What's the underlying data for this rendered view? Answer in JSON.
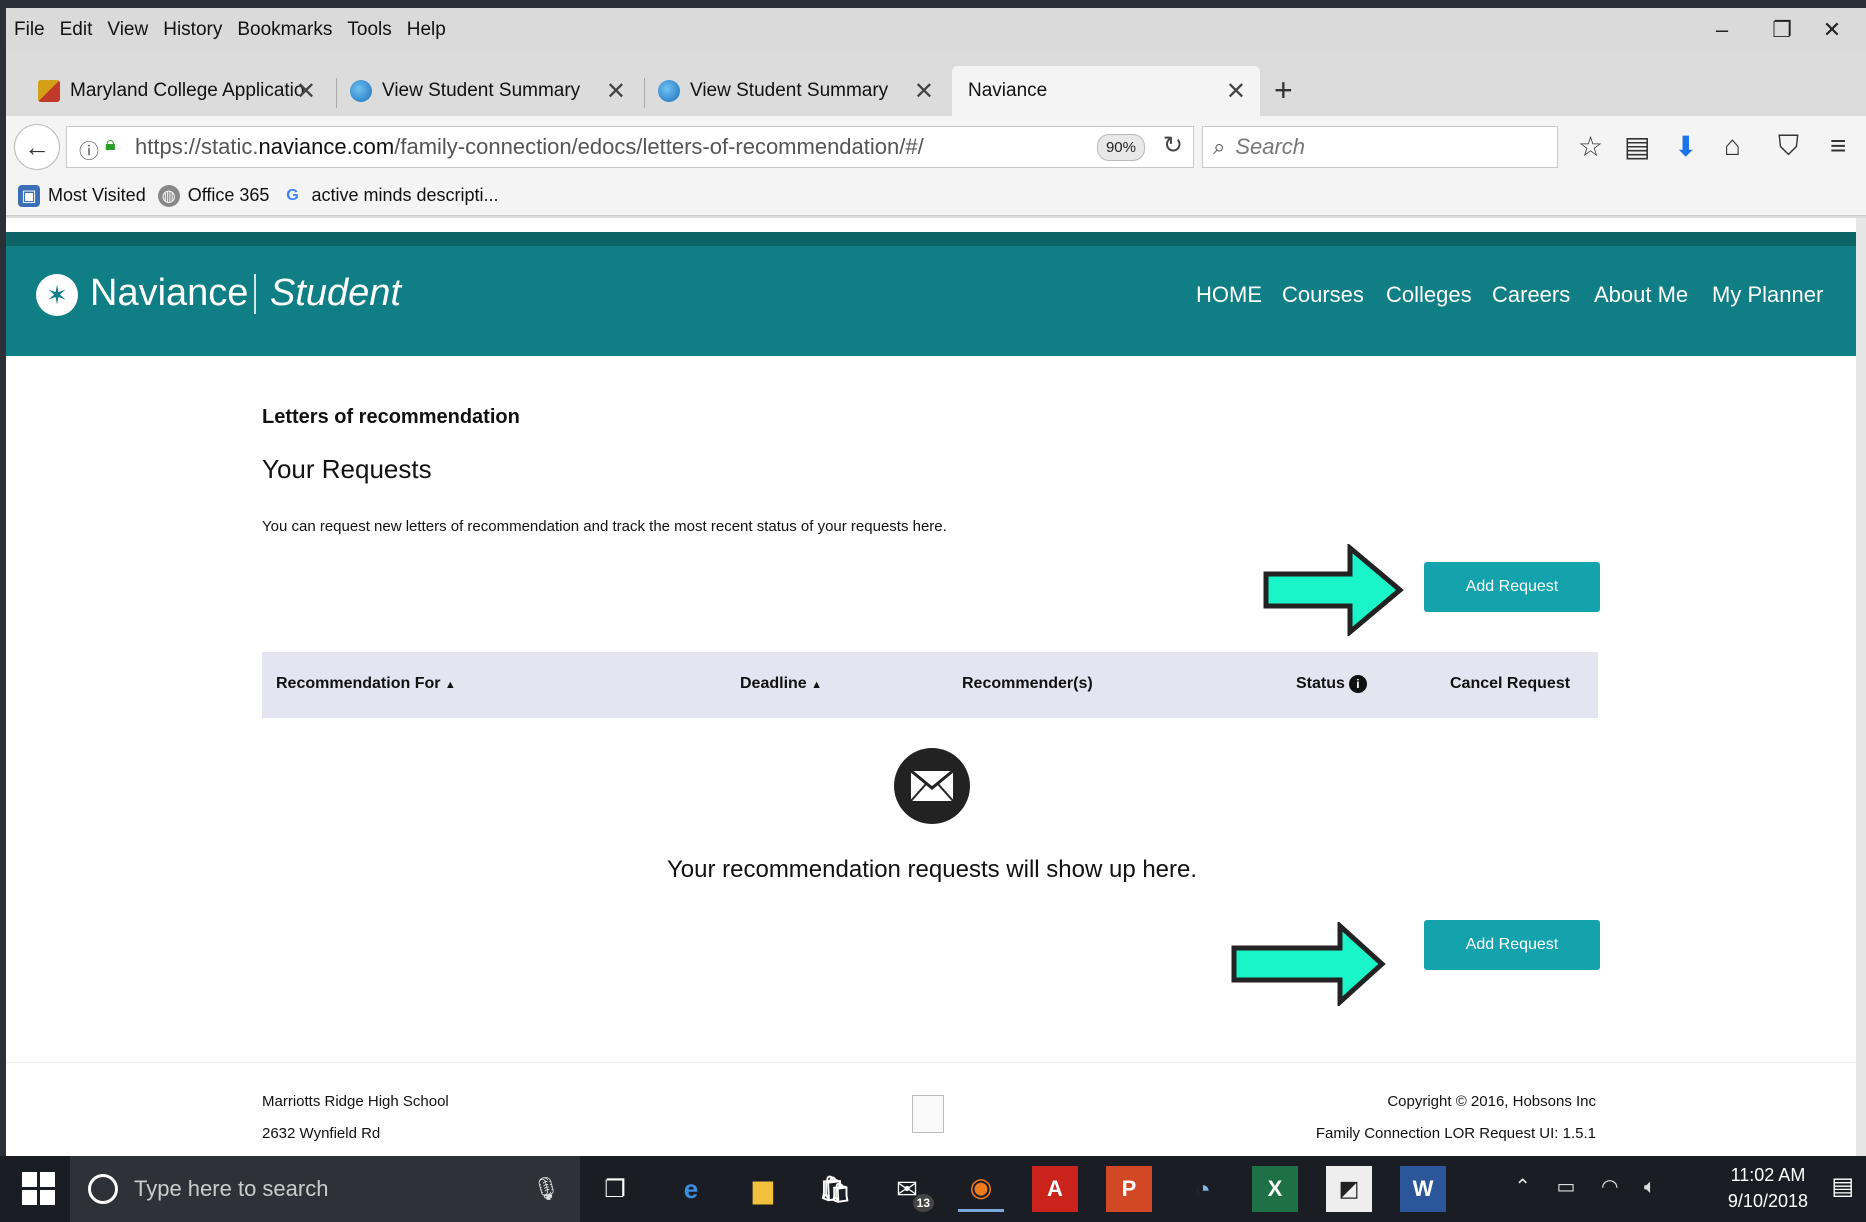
{
  "menu": [
    "File",
    "Edit",
    "View",
    "History",
    "Bookmarks",
    "Tools",
    "Help"
  ],
  "tabs": [
    {
      "label": "Maryland College Applicatio",
      "icon": "maryland-flag-icon"
    },
    {
      "label": "View Student Summary",
      "icon": "globe-icon"
    },
    {
      "label": "View Student Summary",
      "icon": "globe-icon"
    },
    {
      "label": "Naviance",
      "icon": "none"
    }
  ],
  "address": {
    "url_prefix": "https://static.",
    "url_domain": "naviance.com",
    "url_path": "/family-connection/edocs/letters-of-recommendation/#/",
    "zoom": "90%"
  },
  "search": {
    "placeholder": "Search"
  },
  "bookmarks": [
    "Most Visited",
    "Office 365",
    "active minds descripti..."
  ],
  "site": {
    "brand": "Naviance",
    "sub": "Student",
    "nav": [
      "HOME",
      "Courses",
      "Colleges",
      "Careers",
      "About Me",
      "My Planner"
    ]
  },
  "main": {
    "section_title": "Letters of recommendation",
    "heading": "Your Requests",
    "intro": "You can request new letters of recommendation and track the most recent status of your requests here.",
    "add_button": "Add Request",
    "columns": [
      "Recommendation For",
      "Deadline",
      "Recommender(s)",
      "Status",
      "Cancel Request"
    ],
    "empty_message": "Your recommendation requests will show up here."
  },
  "footer": {
    "school": "Marriotts Ridge High School",
    "address": "2632 Wynfield Rd",
    "copyright": "Copyright © 2016, Hobsons Inc",
    "version": "Family Connection LOR Request UI: 1.5.1"
  },
  "taskbar": {
    "search_placeholder": "Type here to search",
    "time": "11:02 AM",
    "date": "9/10/2018",
    "mail_badge": "13"
  },
  "colors": {
    "teal": "#107e85",
    "button": "#14a3ad",
    "arrow": "#19f5c8"
  }
}
